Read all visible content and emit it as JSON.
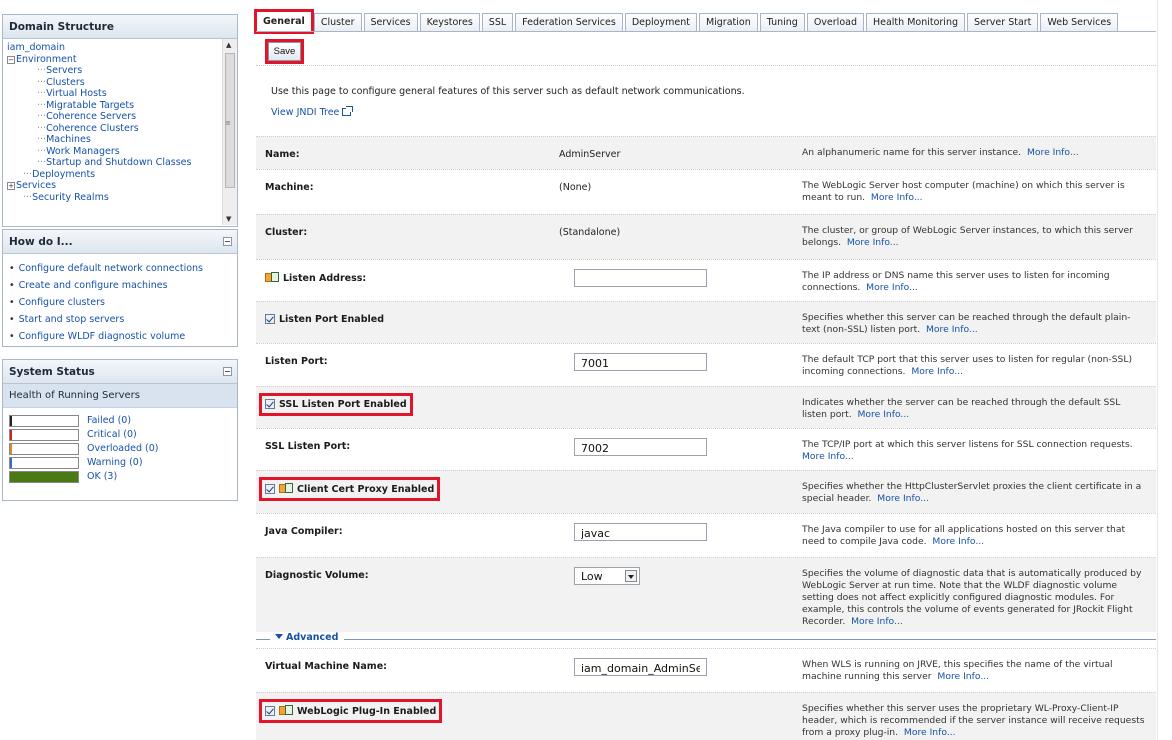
{
  "domain_structure": {
    "title": "Domain Structure",
    "items": [
      {
        "text": "iam_domain",
        "level": 1,
        "toggle": ""
      },
      {
        "text": "Environment",
        "level": 1,
        "toggle": "−"
      },
      {
        "text": "Servers",
        "level": 3,
        "toggle": ""
      },
      {
        "text": "Clusters",
        "level": 3,
        "toggle": ""
      },
      {
        "text": "Virtual Hosts",
        "level": 3,
        "toggle": ""
      },
      {
        "text": "Migratable Targets",
        "level": 3,
        "toggle": ""
      },
      {
        "text": "Coherence Servers",
        "level": 3,
        "toggle": ""
      },
      {
        "text": "Coherence Clusters",
        "level": 3,
        "toggle": ""
      },
      {
        "text": "Machines",
        "level": 3,
        "toggle": ""
      },
      {
        "text": "Work Managers",
        "level": 3,
        "toggle": ""
      },
      {
        "text": "Startup and Shutdown Classes",
        "level": 3,
        "toggle": ""
      },
      {
        "text": "Deployments",
        "level": 2,
        "toggle": ""
      },
      {
        "text": "Services",
        "level": 1,
        "toggle": "+"
      },
      {
        "text": "Security Realms",
        "level": 2,
        "toggle": ""
      }
    ]
  },
  "how_do_i": {
    "title": "How do I...",
    "items": [
      "Configure default network connections",
      "Create and configure machines",
      "Configure clusters",
      "Start and stop servers",
      "Configure WLDF diagnostic volume"
    ]
  },
  "system_status": {
    "title": "System Status",
    "health_heading": "Health of Running Servers",
    "rows": [
      {
        "label": "Failed (0)",
        "color": "#222222",
        "fill": 0
      },
      {
        "label": "Critical (0)",
        "color": "#cc2222",
        "fill": 0
      },
      {
        "label": "Overloaded (0)",
        "color": "#e08a1e",
        "fill": 0
      },
      {
        "label": "Warning (0)",
        "color": "#3a6fb8",
        "fill": 0
      },
      {
        "label": "OK (3)",
        "color": "#4a7a16",
        "fill": 1
      }
    ]
  },
  "tabs": [
    "General",
    "Cluster",
    "Services",
    "Keystores",
    "SSL",
    "Federation Services",
    "Deployment",
    "Migration",
    "Tuning",
    "Overload",
    "Health Monitoring",
    "Server Start",
    "Web Services"
  ],
  "active_tab": "General",
  "save_label": "Save",
  "intro_text": "Use this page to configure general features of this server such as default network communications.",
  "jndi_link": "View JNDI Tree",
  "more_info": "More Info...",
  "fields": {
    "name": {
      "label": "Name:",
      "value": "AdminServer",
      "desc": "An alphanumeric name for this server instance."
    },
    "machine": {
      "label": "Machine:",
      "value": "(None)",
      "desc": "The WebLogic Server host computer (machine) on which this server is meant to run."
    },
    "cluster": {
      "label": "Cluster:",
      "value": "(Standalone)",
      "desc": "The cluster, or group of WebLogic Server instances, to which this server belongs."
    },
    "listen_address": {
      "label": "Listen Address:",
      "value": "",
      "desc": "The IP address or DNS name this server uses to listen for incoming connections."
    },
    "listen_port_enabled": {
      "label": "Listen Port Enabled",
      "desc": "Specifies whether this server can be reached through the default plain-text (non-SSL) listen port."
    },
    "listen_port": {
      "label": "Listen Port:",
      "value": "7001",
      "desc": "The default TCP port that this server uses to listen for regular (non-SSL) incoming connections."
    },
    "ssl_listen_port_enabled": {
      "label": "SSL Listen Port Enabled",
      "desc": "Indicates whether the server can be reached through the default SSL listen port."
    },
    "ssl_listen_port": {
      "label": "SSL Listen Port:",
      "value": "7002",
      "desc": "The TCP/IP port at which this server listens for SSL connection requests."
    },
    "client_cert_proxy": {
      "label": "Client Cert Proxy Enabled",
      "desc": "Specifies whether the HttpClusterServlet proxies the client certificate in a special header."
    },
    "java_compiler": {
      "label": "Java Compiler:",
      "value": "javac",
      "desc": "The Java compiler to use for all applications hosted on this server that need to compile Java code."
    },
    "diagnostic_volume": {
      "label": "Diagnostic Volume:",
      "value": "Low",
      "desc": "Specifies the volume of diagnostic data that is automatically produced by WebLogic Server at run time. Note that the WLDF diagnostic volume setting does not affect explicitly configured diagnostic modules. For example, this controls the volume of events generated for JRockit Flight Recorder."
    },
    "advanced_label": "Advanced",
    "vm_name": {
      "label": "Virtual Machine Name:",
      "value": "iam_domain_AdminServer",
      "desc": "When WLS is running on JRVE, this specifies the name of the virtual machine running this server"
    },
    "weblogic_plugin": {
      "label": "WebLogic Plug-In Enabled",
      "desc": "Specifies whether this server uses the proprietary WL-Proxy-Client-IP header, which is recommended if the server instance will receive requests from a proxy plug-in."
    }
  }
}
